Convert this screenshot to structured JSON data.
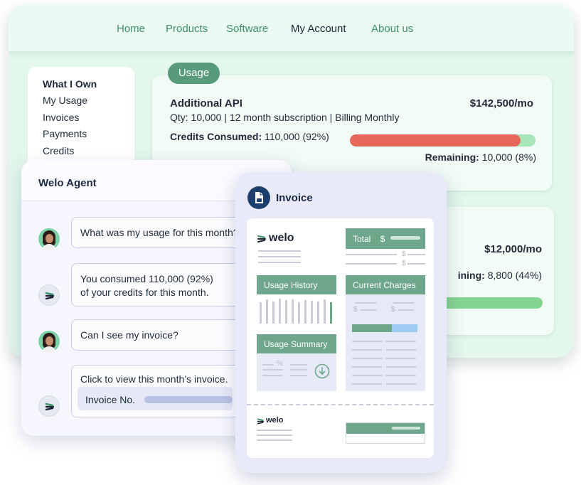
{
  "nav": {
    "items": [
      "Home",
      "Products",
      "Software",
      "My Account",
      "About us"
    ],
    "active": "My Account"
  },
  "sidebar": {
    "items": [
      "What I Own",
      "My Usage",
      "Invoices",
      "Payments",
      "Credits"
    ]
  },
  "usage": {
    "pill_label": "Usage",
    "card1": {
      "title": "Additional API",
      "price": "$142,500/mo",
      "subtitle": "Qty: 10,000 | 12 month subscription | Billing Monthly",
      "consumed_label": "Credits Consumed:",
      "consumed_value": "110,000 (92%)",
      "consumed_fraction": 0.92,
      "remaining_label": "Remaining:",
      "remaining_value": "10,000 (8%)"
    },
    "card2": {
      "price": "$12,000/mo",
      "remaining_partial_label": "ining:",
      "remaining_value": "8,800 (44%)"
    }
  },
  "chat": {
    "title": "Welo Agent",
    "messages": [
      {
        "role": "user",
        "text": "What was my usage for this month?"
      },
      {
        "role": "agent",
        "line1": "You consumed 110,000 (92%)",
        "line2": "of your credits for this month."
      },
      {
        "role": "user",
        "text": "Can I see my invoice?"
      },
      {
        "role": "agent",
        "text": "Click to view this month’s invoice.",
        "field_label": "Invoice No."
      }
    ]
  },
  "invoice": {
    "title": "Invoice",
    "brand": "welo",
    "total_label": "Total",
    "currency_symbol": "$",
    "usage_history_label": "Usage History",
    "current_charges_label": "Current Charges",
    "usage_summary_label": "Usage Summary",
    "percent_symbol": "%"
  },
  "colors": {
    "accent_green": "#579b7b",
    "progress_red": "#e9675a",
    "progress_green": "#a7e6b8",
    "invoice_navy": "#1d3f6e"
  }
}
